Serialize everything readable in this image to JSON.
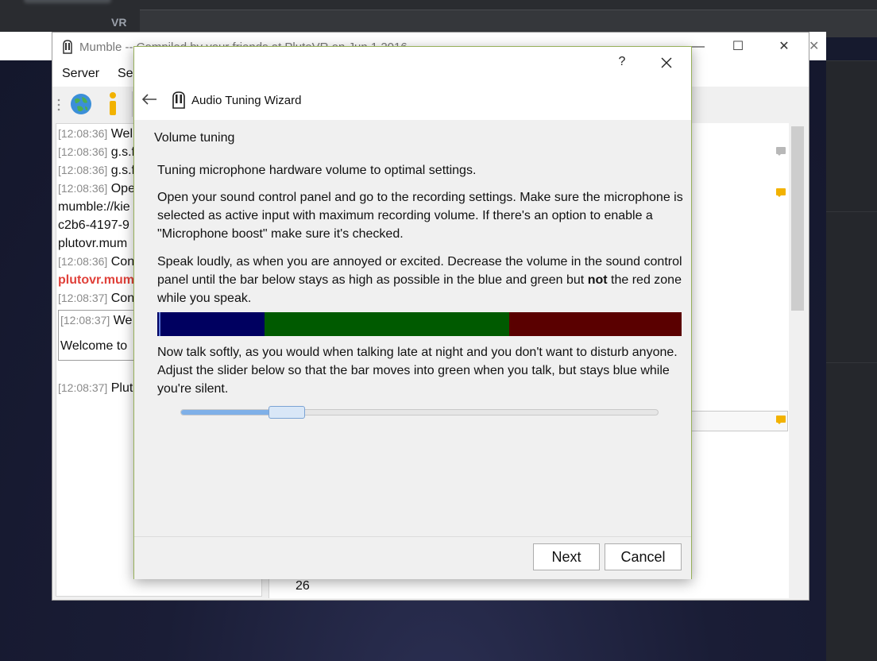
{
  "background": {
    "vr_label": "VR"
  },
  "mumble": {
    "title": "Mumble -- Compiled by your friends at PlutoVR on Jun  1 2016",
    "menu": [
      "Server",
      "Sel"
    ],
    "chat": [
      {
        "ts": "[12:08:36]",
        "text": "Wel"
      },
      {
        "ts": "[12:08:36]",
        "text": "g.s.f"
      },
      {
        "ts": "[12:08:36]",
        "text": "g.s.f"
      },
      {
        "ts": "[12:08:36]",
        "text": "Ope"
      },
      {
        "ts": "",
        "text": "mumble://kie"
      },
      {
        "ts": "",
        "text": "c2b6-4197-9"
      },
      {
        "ts": "",
        "text": "plutovr.mum"
      },
      {
        "ts": "[12:08:36]",
        "text": "Con"
      },
      {
        "ts": "",
        "text": "plutovr.mum"
      },
      {
        "ts": "[12:08:37]",
        "text": "Con"
      },
      {
        "ts": "[12:08:37]",
        "text": "We"
      },
      {
        "ts": "",
        "text": "Welcome to"
      },
      {
        "ts": "[12:08:37]",
        "text": "Plut"
      }
    ],
    "right_number": "26"
  },
  "wizard": {
    "help_label": "?",
    "title": "Audio Tuning Wizard",
    "section_title": "Volume tuning",
    "para1": "Tuning microphone hardware volume to optimal settings.",
    "para2": "Open your sound control panel and go to the recording settings. Make sure the microphone is selected as active input with maximum recording volume. If there's an option to enable a \"Microphone boost\" make sure it's checked.",
    "para3_before": "Speak loudly, as when you are annoyed or excited. Decrease the volume in the sound control panel until the bar below stays as high as possible in the blue and green but ",
    "para3_bold": "not",
    "para3_after": " the red zone while you speak.",
    "para4": "Now talk softly, as you would when talking late at night and you don't want to disturb anyone. Adjust the slider below so that the bar moves into green when you talk, but stays blue while you're silent.",
    "vu_zones": [
      {
        "name": "blue",
        "color": "#000060",
        "fraction": 0.205
      },
      {
        "name": "green",
        "color": "#005a00",
        "fraction": 0.466
      },
      {
        "name": "red",
        "color": "#5a0000",
        "fraction": 0.329
      }
    ],
    "slider_value": 0.2,
    "next_label": "Next",
    "cancel_label": "Cancel"
  }
}
